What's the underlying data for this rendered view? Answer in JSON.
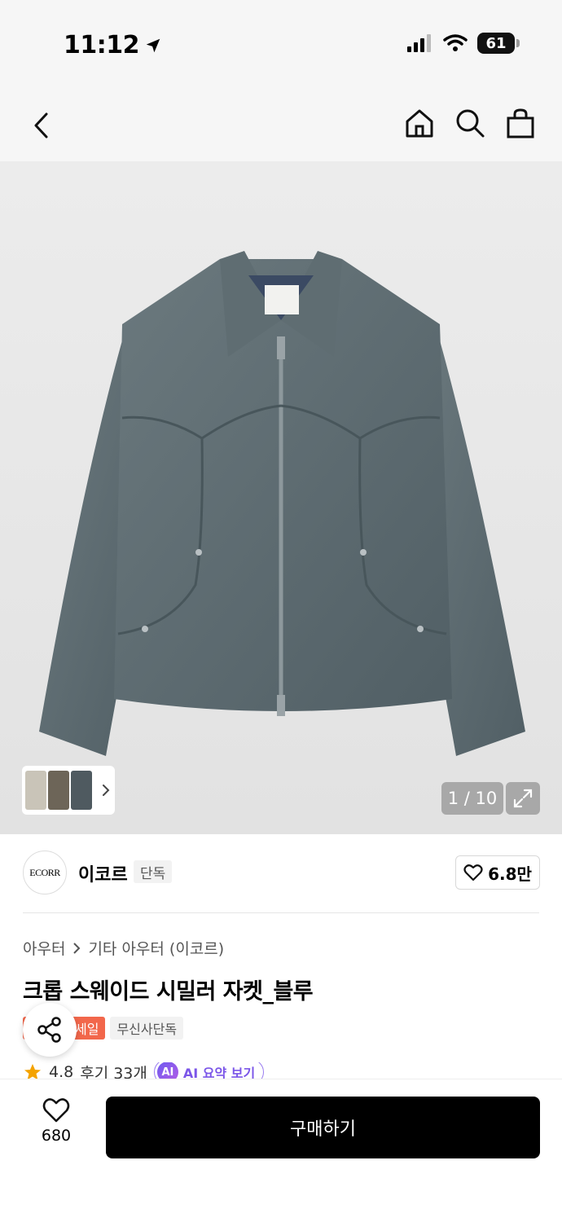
{
  "status": {
    "time": "11:12",
    "battery": "61"
  },
  "nav": {
    "back_icon": "chevron-left-icon",
    "home_icon": "home-icon",
    "search_icon": "search-icon",
    "bag_icon": "shopping-bag-icon"
  },
  "gallery": {
    "counter": "1 / 10",
    "expand_icon": "expand-icon"
  },
  "brand": {
    "logo_text": "ECORR",
    "name": "이코르",
    "badge": "단독",
    "likes": "6.8만"
  },
  "product": {
    "breadcrumb": [
      "아우터",
      "기타 아우터 (이코르)"
    ],
    "title": "크롭 스웨이드 시밀러 자켓_블루",
    "tags": {
      "sale": "세일",
      "exclusive": "무신사단독"
    },
    "rating": "4.8",
    "reviews": "후기 33개",
    "ai_badge": "AI",
    "ai_summary": "AI 요약 보기"
  },
  "bottom": {
    "wish_count": "680",
    "buy_label": "구매하기"
  },
  "colors": {
    "sale": "#f2674b",
    "ai_accent": "#7b56e8",
    "jacket": "#5b6a70"
  }
}
